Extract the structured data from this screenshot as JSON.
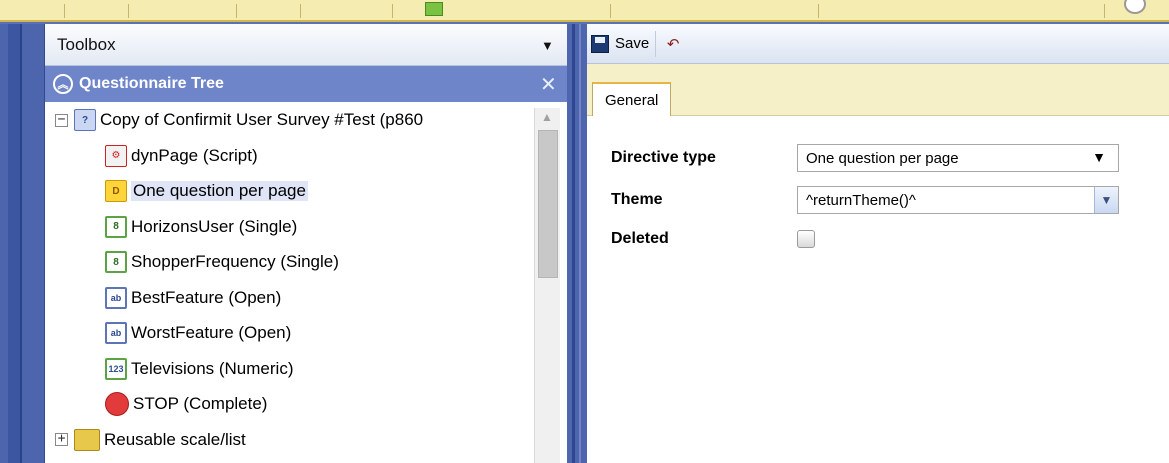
{
  "left_panel": {
    "toolbox_title": "Toolbox",
    "tree_title": "Questionnaire Tree",
    "close_glyph": "✕",
    "tree": [
      {
        "label": "Copy of Confirmit User Survey #Test (p860",
        "icon": "survey-icon",
        "icon_text": "?",
        "level": 0,
        "expander": "−"
      },
      {
        "label": "dynPage (Script)",
        "icon": "script-icon",
        "icon_text": "⚙",
        "level": 1
      },
      {
        "label": "One question per page",
        "icon": "directive-icon",
        "icon_text": "D",
        "level": 1,
        "selected": true
      },
      {
        "label": "HorizonsUser (Single)",
        "icon": "single-choice-icon",
        "icon_text": "8",
        "level": 1
      },
      {
        "label": "ShopperFrequency (Single)",
        "icon": "single-choice-icon",
        "icon_text": "8",
        "level": 1
      },
      {
        "label": "BestFeature (Open)",
        "icon": "open-text-icon",
        "icon_text": "ab",
        "level": 1
      },
      {
        "label": "WorstFeature (Open)",
        "icon": "open-text-icon",
        "icon_text": "ab",
        "level": 1
      },
      {
        "label": "Televisions (Numeric)",
        "icon": "numeric-icon",
        "icon_text": "123",
        "level": 1
      },
      {
        "label": "STOP (Complete)",
        "icon": "stop-icon",
        "icon_text": "",
        "level": 1
      },
      {
        "label": "Reusable scale/list",
        "icon": "folder-icon",
        "icon_text": "",
        "level": 0,
        "expander": "+"
      }
    ]
  },
  "right_panel": {
    "save_label": "Save",
    "tab_general": "General",
    "directive_type_label": "Directive type",
    "directive_type_value": "One question per page",
    "theme_label": "Theme",
    "theme_value": "^returnTheme()^",
    "deleted_label": "Deleted"
  },
  "colors": {
    "accent_blue": "#6e85c9",
    "frame_blue": "#4d65ad",
    "tab_strip": "#f6f0c8"
  }
}
